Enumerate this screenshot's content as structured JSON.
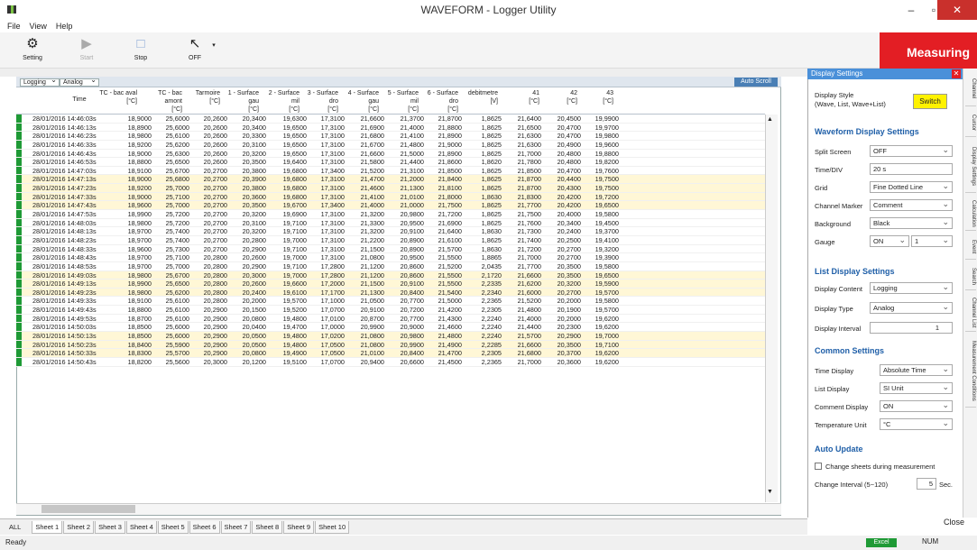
{
  "window": {
    "title": "WAVEFORM - Logger Utility",
    "minimize": "–",
    "maximize": "▫",
    "close": "✕"
  },
  "menu": [
    "File",
    "View",
    "Help"
  ],
  "toolbar": {
    "setting": "Setting",
    "start": "Start",
    "stop": "Stop",
    "off": "OFF",
    "measuring": "Measuring"
  },
  "grid": {
    "logging": "Logging",
    "analog": "Analog",
    "auto_scroll": "Auto Scroll",
    "time_header": "Time",
    "columns": [
      {
        "name": "TC - bac aval",
        "unit": "[°C]"
      },
      {
        "name": "TC - bac amont",
        "unit": "[°C]"
      },
      {
        "name": "Tarmoire",
        "unit": "[°C]"
      },
      {
        "name": "1 - Surface gau",
        "unit": "[°C]"
      },
      {
        "name": "2 - Surface mil",
        "unit": "[°C]"
      },
      {
        "name": "3 - Surface dro",
        "unit": "[°C]"
      },
      {
        "name": "4 - Surface gau",
        "unit": "[°C]"
      },
      {
        "name": "5 - Surface mil",
        "unit": "[°C]"
      },
      {
        "name": "6 - Surface dro",
        "unit": "[°C]"
      },
      {
        "name": "debitmetre",
        "unit": "[V]"
      },
      {
        "name": "41",
        "unit": "[°C]"
      },
      {
        "name": "42",
        "unit": "[°C]"
      },
      {
        "name": "43",
        "unit": "[°C]"
      }
    ],
    "rows": [
      [
        "28/01/2016 14:46:03s",
        "18,9000",
        "25,6000",
        "20,2600",
        "20,3400",
        "19,6300",
        "17,3100",
        "21,6600",
        "21,3700",
        "21,8700",
        "1,8625",
        "21,6400",
        "20,4500",
        "19,9900"
      ],
      [
        "28/01/2016 14:46:13s",
        "18,8900",
        "25,6000",
        "20,2600",
        "20,3400",
        "19,6500",
        "17,3100",
        "21,6900",
        "21,4000",
        "21,8800",
        "1,8625",
        "21,6500",
        "20,4700",
        "19,9700"
      ],
      [
        "28/01/2016 14:46:23s",
        "18,9800",
        "25,6100",
        "20,2600",
        "20,3300",
        "19,6500",
        "17,3100",
        "21,6800",
        "21,4100",
        "21,8900",
        "1,8625",
        "21,6300",
        "20,4700",
        "19,9800"
      ],
      [
        "28/01/2016 14:46:33s",
        "18,9200",
        "25,6200",
        "20,2600",
        "20,3100",
        "19,6500",
        "17,3100",
        "21,6700",
        "21,4800",
        "21,9000",
        "1,8625",
        "21,6300",
        "20,4900",
        "19,9600"
      ],
      [
        "28/01/2016 14:46:43s",
        "18,9000",
        "25,6300",
        "20,2600",
        "20,3200",
        "19,6500",
        "17,3100",
        "21,6600",
        "21,5000",
        "21,8900",
        "1,8625",
        "21,7000",
        "20,4800",
        "19,8800"
      ],
      [
        "28/01/2016 14:46:53s",
        "18,8800",
        "25,6500",
        "20,2600",
        "20,3500",
        "19,6400",
        "17,3100",
        "21,5800",
        "21,4400",
        "21,8600",
        "1,8620",
        "21,7800",
        "20,4800",
        "19,8200"
      ],
      [
        "28/01/2016 14:47:03s",
        "18,9100",
        "25,6700",
        "20,2700",
        "20,3800",
        "19,6800",
        "17,3400",
        "21,5200",
        "21,3100",
        "21,8500",
        "1,8625",
        "21,8500",
        "20,4700",
        "19,7600"
      ],
      [
        "28/01/2016 14:47:13s",
        "18,9000",
        "25,6800",
        "20,2700",
        "20,3900",
        "19,6800",
        "17,3100",
        "21,4700",
        "21,2000",
        "21,8400",
        "1,8625",
        "21,8700",
        "20,4400",
        "19,7500"
      ],
      [
        "28/01/2016 14:47:23s",
        "18,9200",
        "25,7000",
        "20,2700",
        "20,3800",
        "19,6800",
        "17,3100",
        "21,4600",
        "21,1300",
        "21,8100",
        "1,8625",
        "21,8700",
        "20,4300",
        "19,7500"
      ],
      [
        "28/01/2016 14:47:33s",
        "18,9000",
        "25,7100",
        "20,2700",
        "20,3600",
        "19,6800",
        "17,3100",
        "21,4100",
        "21,0100",
        "21,8000",
        "1,8630",
        "21,8300",
        "20,4200",
        "19,7200"
      ],
      [
        "28/01/2016 14:47:43s",
        "18,9600",
        "25,7000",
        "20,2700",
        "20,3500",
        "19,6700",
        "17,3400",
        "21,4000",
        "21,0000",
        "21,7500",
        "1,8625",
        "21,7700",
        "20,4200",
        "19,6500"
      ],
      [
        "28/01/2016 14:47:53s",
        "18,9900",
        "25,7200",
        "20,2700",
        "20,3200",
        "19,6900",
        "17,3100",
        "21,3200",
        "20,9800",
        "21,7200",
        "1,8625",
        "21,7500",
        "20,4000",
        "19,5800"
      ],
      [
        "28/01/2016 14:48:03s",
        "18,9800",
        "25,7200",
        "20,2700",
        "20,3100",
        "19,7100",
        "17,3100",
        "21,3300",
        "20,9500",
        "21,6900",
        "1,8625",
        "21,7600",
        "20,3400",
        "19,4500"
      ],
      [
        "28/01/2016 14:48:13s",
        "18,9700",
        "25,7400",
        "20,2700",
        "20,3200",
        "19,7100",
        "17,3100",
        "21,3200",
        "20,9100",
        "21,6400",
        "1,8630",
        "21,7300",
        "20,2400",
        "19,3700"
      ],
      [
        "28/01/2016 14:48:23s",
        "18,9700",
        "25,7400",
        "20,2700",
        "20,2800",
        "19,7000",
        "17,3100",
        "21,2200",
        "20,8900",
        "21,6100",
        "1,8625",
        "21,7400",
        "20,2500",
        "19,4100"
      ],
      [
        "28/01/2016 14:48:33s",
        "18,9600",
        "25,7300",
        "20,2700",
        "20,2900",
        "19,7100",
        "17,3100",
        "21,1500",
        "20,8900",
        "21,5700",
        "1,8630",
        "21,7200",
        "20,2700",
        "19,3200"
      ],
      [
        "28/01/2016 14:48:43s",
        "18,9700",
        "25,7100",
        "20,2800",
        "20,2600",
        "19,7000",
        "17,3100",
        "21,0800",
        "20,9500",
        "21,5500",
        "1,8865",
        "21,7000",
        "20,2700",
        "19,3900"
      ],
      [
        "28/01/2016 14:48:53s",
        "18,9700",
        "25,7000",
        "20,2800",
        "20,2900",
        "19,7100",
        "17,2800",
        "21,1200",
        "20,8600",
        "21,5200",
        "2,0435",
        "21,7700",
        "20,3500",
        "19,5800"
      ],
      [
        "28/01/2016 14:49:03s",
        "18,9800",
        "25,6700",
        "20,2800",
        "20,3000",
        "19,7000",
        "17,2800",
        "21,1200",
        "20,8600",
        "21,5500",
        "2,1720",
        "21,6600",
        "20,3500",
        "19,6500"
      ],
      [
        "28/01/2016 14:49:13s",
        "18,9900",
        "25,6500",
        "20,2800",
        "20,2600",
        "19,6600",
        "17,2000",
        "21,1500",
        "20,9100",
        "21,5500",
        "2,2335",
        "21,6200",
        "20,3200",
        "19,5900"
      ],
      [
        "28/01/2016 14:49:23s",
        "18,9800",
        "25,6200",
        "20,2800",
        "20,2400",
        "19,6100",
        "17,1700",
        "21,1300",
        "20,8400",
        "21,5400",
        "2,2340",
        "21,6000",
        "20,2700",
        "19,5700"
      ],
      [
        "28/01/2016 14:49:33s",
        "18,9100",
        "25,6100",
        "20,2800",
        "20,2000",
        "19,5700",
        "17,1000",
        "21,0500",
        "20,7700",
        "21,5000",
        "2,2365",
        "21,5200",
        "20,2000",
        "19,5800"
      ],
      [
        "28/01/2016 14:49:43s",
        "18,8800",
        "25,6100",
        "20,2900",
        "20,1500",
        "19,5200",
        "17,0700",
        "20,9100",
        "20,7200",
        "21,4200",
        "2,2305",
        "21,4800",
        "20,1900",
        "19,5700"
      ],
      [
        "28/01/2016 14:49:53s",
        "18,8700",
        "25,6100",
        "20,2900",
        "20,0800",
        "19,4800",
        "17,0100",
        "20,8700",
        "20,7700",
        "21,4300",
        "2,2240",
        "21,4000",
        "20,2000",
        "19,6200"
      ],
      [
        "28/01/2016 14:50:03s",
        "18,8500",
        "25,6000",
        "20,2900",
        "20,0400",
        "19,4700",
        "17,0000",
        "20,9900",
        "20,9000",
        "21,4600",
        "2,2240",
        "21,4400",
        "20,2300",
        "19,6200"
      ],
      [
        "28/01/2016 14:50:13s",
        "18,8500",
        "25,6000",
        "20,2900",
        "20,0500",
        "19,4800",
        "17,0200",
        "21,0800",
        "20,9800",
        "21,4800",
        "2,2240",
        "21,5700",
        "20,2900",
        "19,7000"
      ],
      [
        "28/01/2016 14:50:23s",
        "18,8400",
        "25,5900",
        "20,2900",
        "20,0500",
        "19,4800",
        "17,0500",
        "21,0800",
        "20,9900",
        "21,4900",
        "2,2285",
        "21,6600",
        "20,3500",
        "19,7100"
      ],
      [
        "28/01/2016 14:50:33s",
        "18,8300",
        "25,5700",
        "20,2900",
        "20,0800",
        "19,4900",
        "17,0500",
        "21,0100",
        "20,8400",
        "21,4700",
        "2,2305",
        "21,6800",
        "20,3700",
        "19,6200"
      ],
      [
        "28/01/2016 14:50:43s",
        "18,8200",
        "25,5600",
        "20,3000",
        "20,1200",
        "19,5100",
        "17,0700",
        "20,9400",
        "20,6600",
        "21,4500",
        "2,2365",
        "21,7000",
        "20,3600",
        "19,6200"
      ]
    ]
  },
  "sheets": {
    "all": "ALL",
    "tabs": [
      "Sheet 1",
      "Sheet 2",
      "Sheet 3",
      "Sheet 4",
      "Sheet 5",
      "Sheet 6",
      "Sheet 7",
      "Sheet 8",
      "Sheet 9",
      "Sheet 10"
    ]
  },
  "status": {
    "ready": "Ready",
    "excel": "Excel",
    "num": "NUM"
  },
  "panel": {
    "title": "Display Settings",
    "display_style_label": "Display Style",
    "display_style_sub": "(Wave, List, Wave+List)",
    "switch": "Switch",
    "waveform": {
      "title": "Waveform Display Settings",
      "split_screen_label": "Split Screen",
      "split_screen": "OFF",
      "time_div_label": "Time/DIV",
      "time_div": "20 s",
      "grid_label": "Grid",
      "grid": "Fine Dotted Line",
      "channel_marker_label": "Channel Marker",
      "channel_marker": "Comment",
      "background_label": "Background",
      "background": "Black",
      "gauge_label": "Gauge",
      "gauge": "ON",
      "gauge_n": "1"
    },
    "list": {
      "title": "List Display Settings",
      "content_label": "Display Content",
      "content": "Logging",
      "type_label": "Display Type",
      "type": "Analog",
      "interval_label": "Display Interval",
      "interval": "1"
    },
    "common": {
      "title": "Common Settings",
      "time_display_label": "Time Display",
      "time_display": "Absolute Time",
      "list_display_label": "List Display",
      "list_display": "SI Unit",
      "comment_display_label": "Comment Display",
      "comment_display": "ON",
      "temp_unit_label": "Temperature Unit",
      "temp_unit": "°C"
    },
    "auto_update": {
      "title": "Auto Update",
      "change_sheets": "Change sheets during measurement",
      "change_interval_label": "Change Interval (5~120)",
      "change_interval": "5",
      "sec": "Sec."
    },
    "close": "Close",
    "tabs": [
      "Channel",
      "Cursor",
      "Display Settings",
      "Calculation",
      "Event",
      "Search",
      "Channel List",
      "Measurement Conditions"
    ]
  }
}
